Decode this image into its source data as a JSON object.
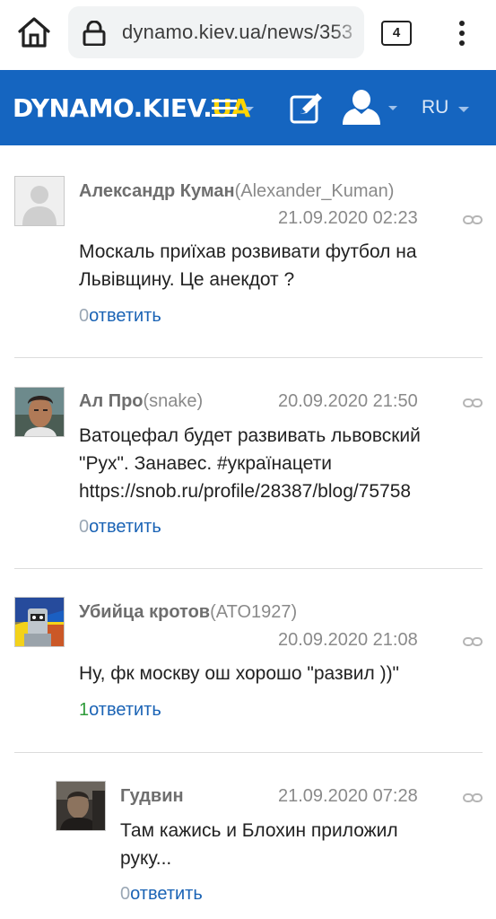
{
  "browser": {
    "url": "dynamo.kiev.ua/news/353",
    "tab_count": "4"
  },
  "site": {
    "logo_main": "DYNAMO.KIEV.",
    "logo_accent": "UA",
    "lang": "RU",
    "colors": {
      "header": "#1565c0",
      "accent": "#ffd500",
      "reply_link": "#1a63b5",
      "positive_count": "#2e9b3a"
    }
  },
  "comments": [
    {
      "name": "Александр Куман",
      "login": "(Alexander_Kuman)",
      "date": "21.09.2020 02:23",
      "text": "Москаль приїхав розвивати футбол на Львівщину. Це анекдот ?",
      "count": "0",
      "reply": "ответить"
    },
    {
      "name": "Ал Про",
      "login": "(snake)",
      "date": "20.09.2020 21:50",
      "text": "Ватоцефал будет развивать львовский \"Рух\". Занавес. #українацети https://snob.ru/profile/28387/blog/75758",
      "count": "0",
      "reply": "ответить"
    },
    {
      "name": "Убийца кротов",
      "login": "(ATO1927)",
      "date": "20.09.2020 21:08",
      "text": "Ну, фк москву ош хорошо \"развил ))\"",
      "count": "1",
      "reply": "ответить"
    },
    {
      "name": "Гудвин",
      "login": "",
      "date": "21.09.2020 07:28",
      "text": "Там кажись и Блохин приложил руку...",
      "count": "0",
      "reply": "ответить"
    }
  ]
}
